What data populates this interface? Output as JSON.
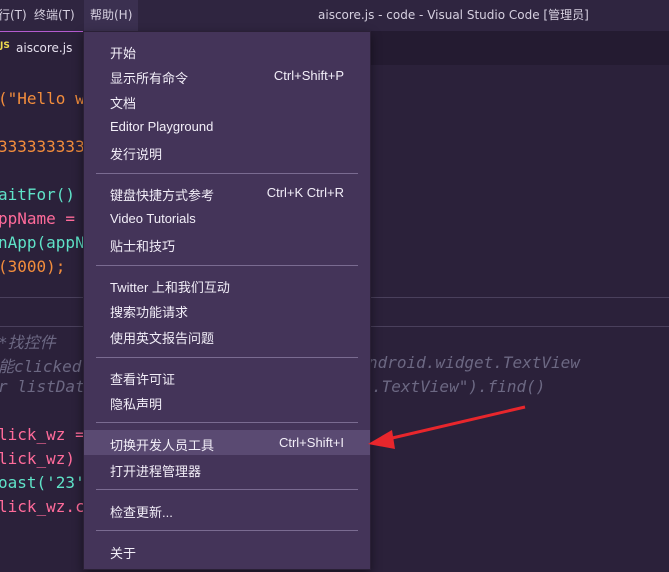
{
  "menubar": {
    "items": [
      {
        "label": "行(T)"
      },
      {
        "label": "终端(T)"
      },
      {
        "label": "帮助(H)"
      }
    ],
    "window_title": "aiscore.js - code - Visual Studio Code [管理员]"
  },
  "tab": {
    "icon_text": "JS",
    "label": "aiscore.js"
  },
  "code": [
    "(\"Hello w",
    "",
    "3333333333",
    "",
    "aitFor()",
    "ppName =",
    "nApp(appN",
    "(3000);",
    "",
    "",
    "*找控件",
    "能clicked",
    "r listDat",
    "",
    "lick_wz =",
    "lick_wz)",
    "oast('23'",
    "lick_wz.c"
  ],
  "code_right": [
    "ndroid.widget.TextView",
    ".TextView\").find()"
  ],
  "help_menu": {
    "items": [
      {
        "label": "开始",
        "shortcut": ""
      },
      {
        "label": "显示所有命令",
        "shortcut": "Ctrl+Shift+P"
      },
      {
        "label": "文档",
        "shortcut": ""
      },
      {
        "label": "Editor Playground",
        "shortcut": ""
      },
      {
        "label": "发行说明",
        "shortcut": ""
      },
      {
        "label": "键盘快捷方式参考",
        "shortcut": "Ctrl+K Ctrl+R"
      },
      {
        "label": "Video Tutorials",
        "shortcut": ""
      },
      {
        "label": "贴士和技巧",
        "shortcut": ""
      },
      {
        "label": "Twitter 上和我们互动",
        "shortcut": ""
      },
      {
        "label": "搜索功能请求",
        "shortcut": ""
      },
      {
        "label": "使用英文报告问题",
        "shortcut": ""
      },
      {
        "label": "查看许可证",
        "shortcut": ""
      },
      {
        "label": "隐私声明",
        "shortcut": ""
      },
      {
        "label": "切换开发人员工具",
        "shortcut": "Ctrl+Shift+I"
      },
      {
        "label": "打开进程管理器",
        "shortcut": ""
      },
      {
        "label": "检查更新...",
        "shortcut": ""
      },
      {
        "label": "关于",
        "shortcut": ""
      }
    ]
  },
  "colors": {
    "accent": "#b45bcf",
    "string": "#f38d3c",
    "number": "#f38d3c",
    "keyword": "#ffd866",
    "function": "#5fe3c8",
    "variable": "#ff6b9a",
    "arrow": "#e8262c"
  }
}
